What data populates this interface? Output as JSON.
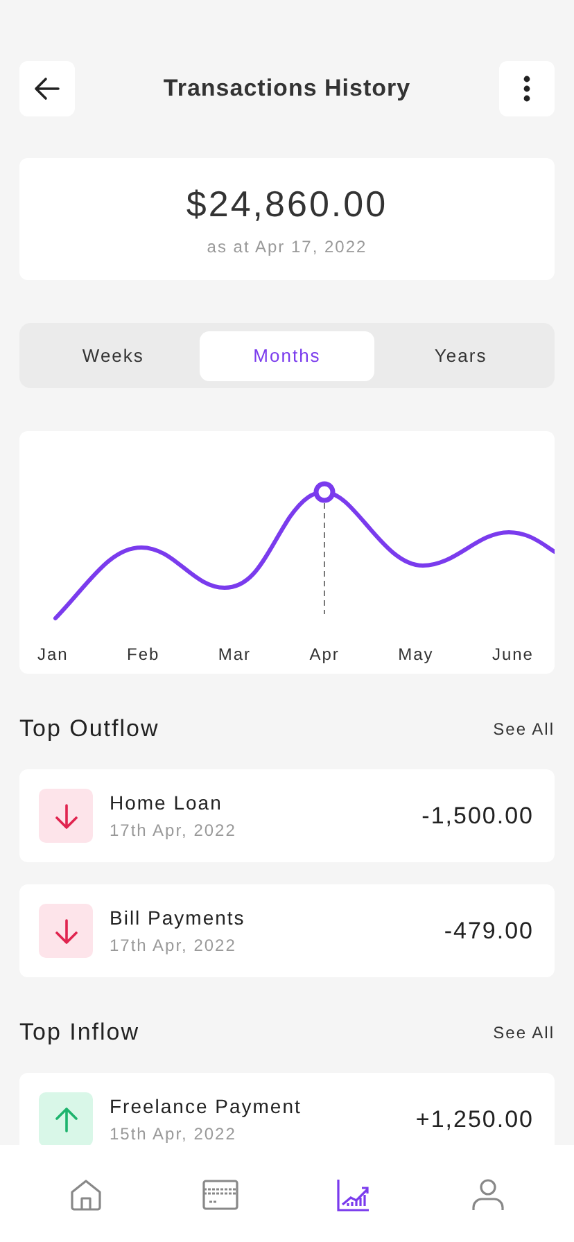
{
  "header": {
    "title": "Transactions History"
  },
  "balance": {
    "amount": "$24,860.00",
    "caption": "as at Apr 17, 2022"
  },
  "periods": [
    {
      "label": "Weeks",
      "selected": false
    },
    {
      "label": "Months",
      "selected": true
    },
    {
      "label": "Years",
      "selected": false
    }
  ],
  "chart": {
    "months": [
      "Jan",
      "Feb",
      "Mar",
      "Apr",
      "May",
      "June"
    ]
  },
  "sections": [
    {
      "title": "Top Outflow",
      "link": "See All",
      "transactions": [
        {
          "kind": "outflow",
          "name": "Home Loan",
          "date": "17th Apr, 2022",
          "amount": "-1,500.00"
        },
        {
          "kind": "outflow",
          "name": "Bill Payments",
          "date": "17th Apr, 2022",
          "amount": "-479.00"
        }
      ]
    },
    {
      "title": "Top Inflow",
      "link": "See All",
      "transactions": [
        {
          "kind": "inflow",
          "name": "Freelance Payment",
          "date": "15th Apr, 2022",
          "amount": "+1,250.00"
        }
      ]
    }
  ],
  "nav": [
    {
      "kind": "home",
      "selected": false
    },
    {
      "kind": "card",
      "selected": false
    },
    {
      "kind": "chart",
      "selected": true
    },
    {
      "kind": "user",
      "selected": false
    }
  ]
}
